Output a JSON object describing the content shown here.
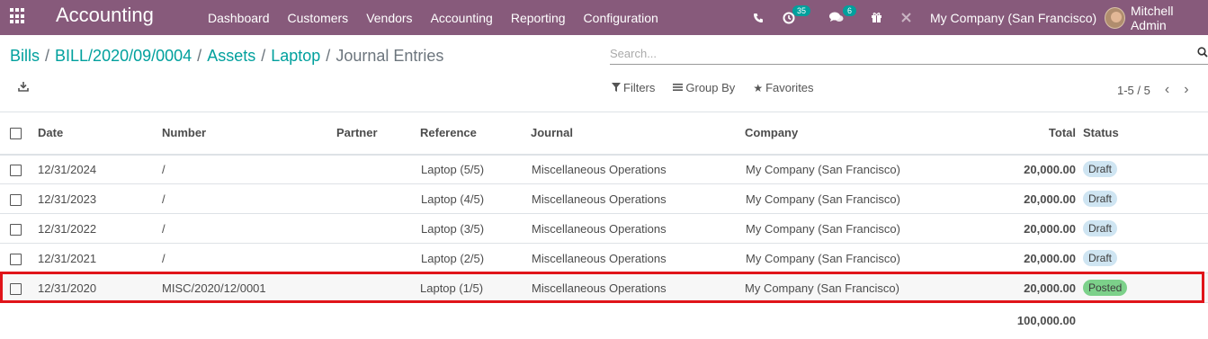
{
  "app": {
    "title": "Accounting",
    "menu": [
      "Dashboard",
      "Customers",
      "Vendors",
      "Accounting",
      "Reporting",
      "Configuration"
    ]
  },
  "systray": {
    "activity_count": "35",
    "message_count": "6",
    "company": "My Company (San Francisco)",
    "user": "Mitchell Admin"
  },
  "breadcrumb": {
    "items": [
      "Bills",
      "BILL/2020/09/0004",
      "Assets",
      "Laptop"
    ],
    "current": "Journal Entries"
  },
  "search": {
    "placeholder": "Search..."
  },
  "filters": {
    "filters": "Filters",
    "group_by": "Group By",
    "favorites": "Favorites"
  },
  "pager": {
    "range": "1-5 / 5"
  },
  "table": {
    "columns": {
      "date": "Date",
      "number": "Number",
      "partner": "Partner",
      "reference": "Reference",
      "journal": "Journal",
      "company": "Company",
      "total": "Total",
      "status": "Status"
    },
    "rows": [
      {
        "date": "12/31/2024",
        "number": "/",
        "partner": "",
        "reference": "Laptop (5/5)",
        "journal": "Miscellaneous Operations",
        "company": "My Company (San Francisco)",
        "total": "20,000.00",
        "status": "Draft"
      },
      {
        "date": "12/31/2023",
        "number": "/",
        "partner": "",
        "reference": "Laptop (4/5)",
        "journal": "Miscellaneous Operations",
        "company": "My Company (San Francisco)",
        "total": "20,000.00",
        "status": "Draft"
      },
      {
        "date": "12/31/2022",
        "number": "/",
        "partner": "",
        "reference": "Laptop (3/5)",
        "journal": "Miscellaneous Operations",
        "company": "My Company (San Francisco)",
        "total": "20,000.00",
        "status": "Draft"
      },
      {
        "date": "12/31/2021",
        "number": "/",
        "partner": "",
        "reference": "Laptop (2/5)",
        "journal": "Miscellaneous Operations",
        "company": "My Company (San Francisco)",
        "total": "20,000.00",
        "status": "Draft"
      },
      {
        "date": "12/31/2020",
        "number": "MISC/2020/12/0001",
        "partner": "",
        "reference": "Laptop (1/5)",
        "journal": "Miscellaneous Operations",
        "company": "My Company (San Francisco)",
        "total": "20,000.00",
        "status": "Posted"
      }
    ],
    "footer_total": "100,000.00"
  },
  "colors": {
    "navbar": "#875a7b",
    "link": "#00a09d",
    "draft": "#cfe5f2",
    "posted": "#7cd18a",
    "highlight": "#e0141a"
  }
}
